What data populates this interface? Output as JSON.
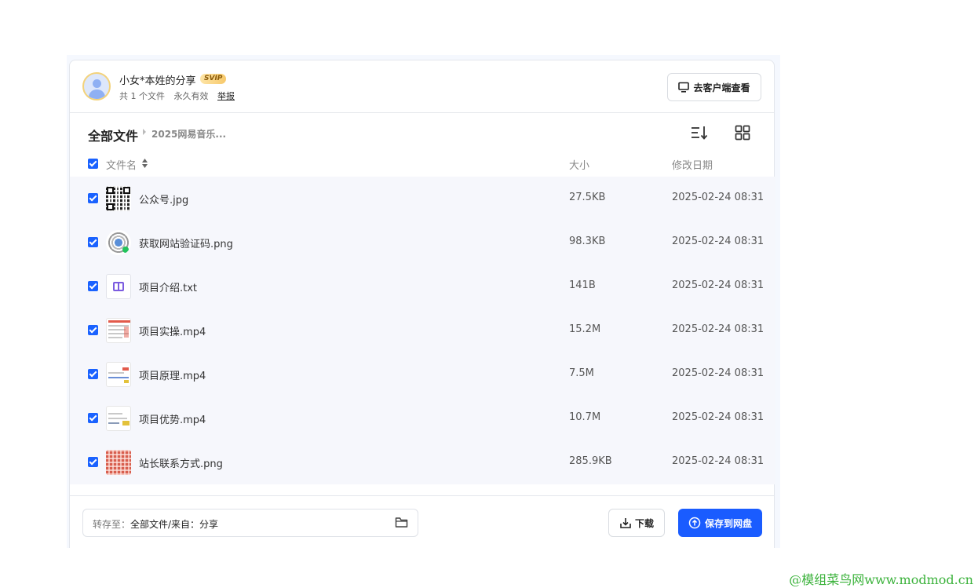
{
  "share": {
    "title": "小女*本姓的分享",
    "badge": "SVIP",
    "file_count": "共 1 个文件",
    "validity": "永久有效",
    "report": "举报",
    "open_client": "去客户端查看"
  },
  "breadcrumb": {
    "root": "全部文件",
    "current": "2025网易音乐..."
  },
  "columns": {
    "name": "文件名",
    "size": "大小",
    "date": "修改日期"
  },
  "files": [
    {
      "name": "公众号.jpg",
      "size": "27.5KB",
      "date": "2025-02-24 08:31",
      "thumb": "qr-code"
    },
    {
      "name": "获取网站验证码.png",
      "size": "98.3KB",
      "date": "2025-02-24 08:31",
      "thumb": "mini-program-code"
    },
    {
      "name": "项目介绍.txt",
      "size": "141B",
      "date": "2025-02-24 08:31",
      "thumb": "text-file-icon"
    },
    {
      "name": "项目实操.mp4",
      "size": "15.2M",
      "date": "2025-02-24 08:31",
      "thumb": "video-frame"
    },
    {
      "name": "项目原理.mp4",
      "size": "7.5M",
      "date": "2025-02-24 08:31",
      "thumb": "video-frame"
    },
    {
      "name": "项目优势.mp4",
      "size": "10.7M",
      "date": "2025-02-24 08:31",
      "thumb": "video-frame"
    },
    {
      "name": "站长联系方式.png",
      "size": "285.9KB",
      "date": "2025-02-24 08:31",
      "thumb": "qr-code-red"
    }
  ],
  "footer": {
    "save_to_label": "转存至：",
    "save_to_path": "全部文件/来自：分享",
    "download": "下载",
    "save": "保存到网盘"
  },
  "watermark": "@模组菜鸟网www.modmod.cn",
  "colors": {
    "accent": "#1a5cff",
    "checkbox": "#1a62ff",
    "list_bg": "#f6f7fc"
  }
}
